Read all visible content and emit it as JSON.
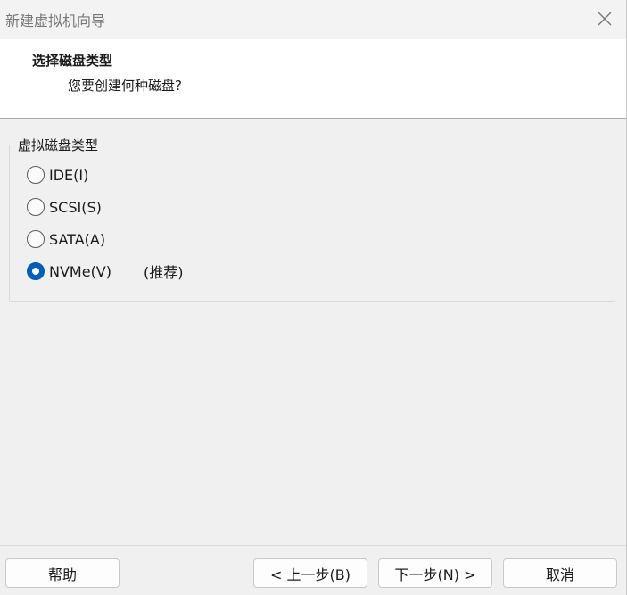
{
  "window": {
    "title": "新建虚拟机向导"
  },
  "header": {
    "title": "选择磁盘类型",
    "subtitle": "您要创建何种磁盘?"
  },
  "group": {
    "legend": "虚拟磁盘类型",
    "options": [
      {
        "label": "IDE(I)",
        "note": "",
        "checked": false
      },
      {
        "label": "SCSI(S)",
        "note": "",
        "checked": false
      },
      {
        "label": "SATA(A)",
        "note": "",
        "checked": false
      },
      {
        "label": "NVMe(V)",
        "note": "(推荐)",
        "checked": true
      }
    ]
  },
  "buttons": {
    "help": "帮助",
    "back": "< 上一步(B)",
    "next": "下一步(N) >",
    "cancel": "取消"
  },
  "colors": {
    "accent": "#005fb8",
    "header_bg": "#ffffff",
    "body_bg": "#f0f0f0"
  },
  "icons": {
    "close": "close-icon"
  }
}
